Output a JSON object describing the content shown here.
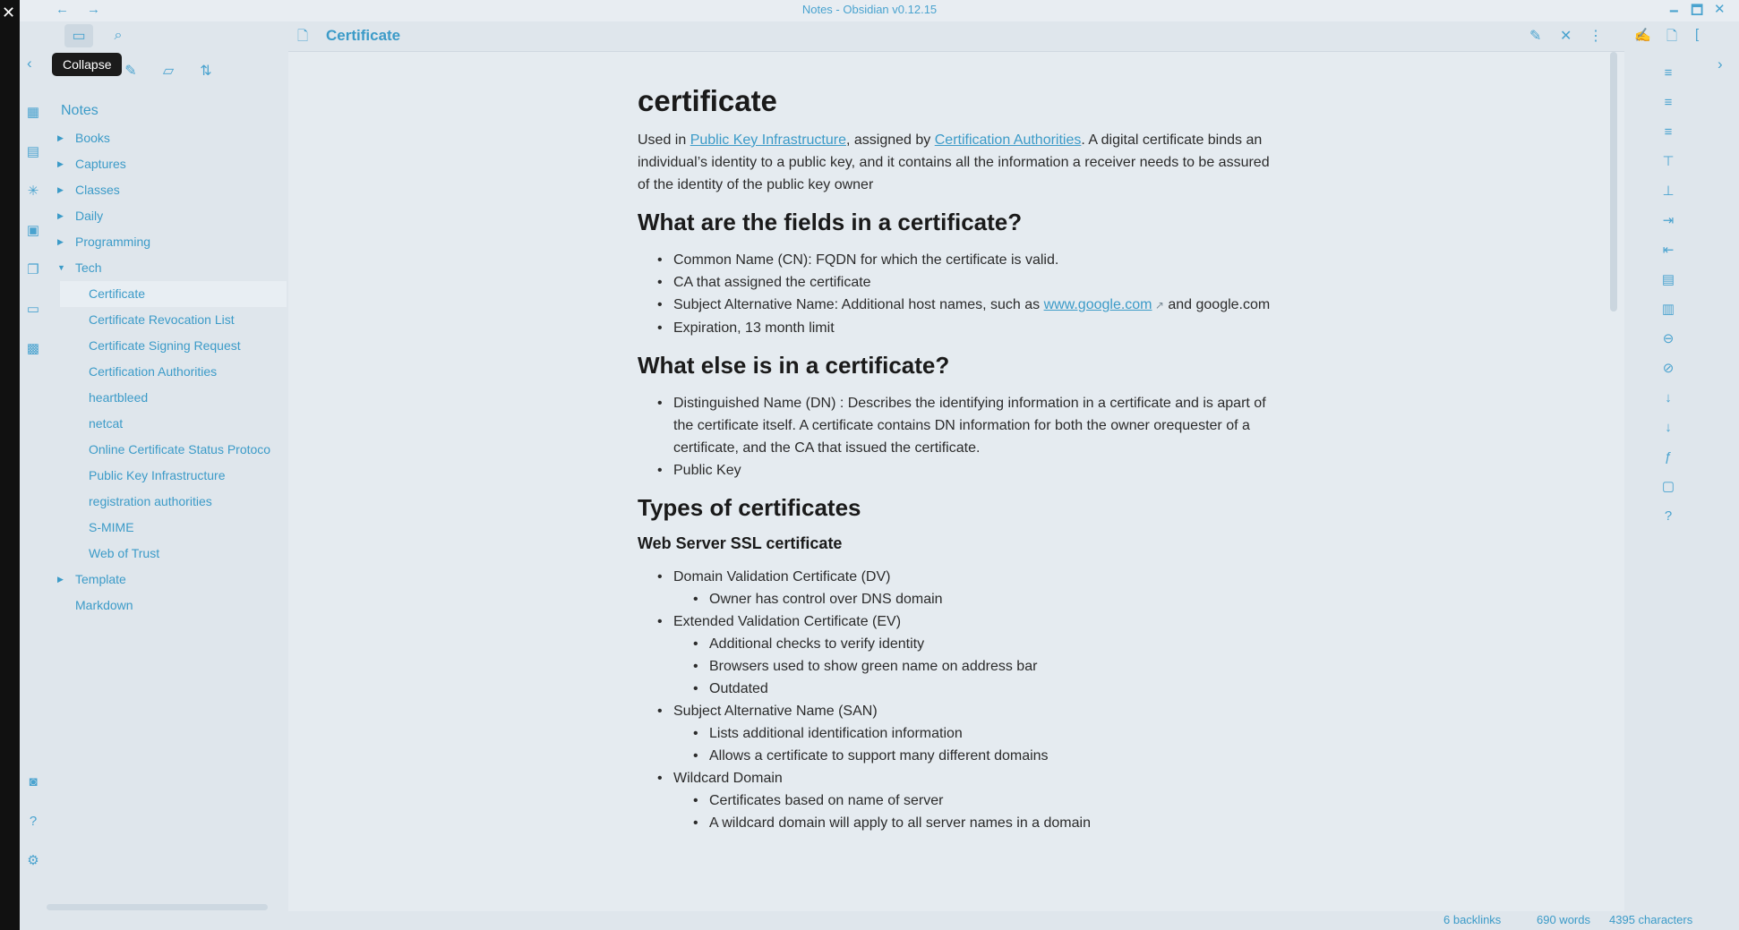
{
  "window": {
    "title": "Notes - Obsidian v0.12.15",
    "back": "←",
    "forward": "→",
    "minimize": "🗕",
    "maximize": "🗖",
    "close": "✕"
  },
  "ribbon": {
    "icons": [
      "table-icon",
      "note-icon",
      "graph-icon",
      "calendar-icon",
      "copy-icon",
      "slides-icon",
      "grid-icon",
      "publish-icon",
      "help-icon",
      "settings-icon"
    ]
  },
  "sidebar": {
    "tooltip": "Collapse",
    "vault_name": "Notes",
    "tree": [
      {
        "label": "Books",
        "type": "folder"
      },
      {
        "label": "Captures",
        "type": "folder"
      },
      {
        "label": "Classes",
        "type": "folder"
      },
      {
        "label": "Daily",
        "type": "folder"
      },
      {
        "label": "Programming",
        "type": "folder"
      },
      {
        "label": "Tech",
        "type": "folder-open"
      },
      {
        "label": "Certificate",
        "type": "file",
        "selected": true
      },
      {
        "label": "Certificate Revocation List",
        "type": "file"
      },
      {
        "label": "Certificate Signing Request",
        "type": "file"
      },
      {
        "label": "Certification Authorities",
        "type": "file"
      },
      {
        "label": "heartbleed",
        "type": "file"
      },
      {
        "label": "netcat",
        "type": "file"
      },
      {
        "label": "Online Certificate Status Protoco",
        "type": "file"
      },
      {
        "label": "Public Key Infrastructure",
        "type": "file"
      },
      {
        "label": "registration authorities",
        "type": "file"
      },
      {
        "label": "S-MIME",
        "type": "file"
      },
      {
        "label": "Web of Trust",
        "type": "file"
      },
      {
        "label": "Template",
        "type": "folder"
      },
      {
        "label": "Markdown",
        "type": "root-file"
      }
    ]
  },
  "pane": {
    "title": "Certificate"
  },
  "doc": {
    "h1": "certificate",
    "intro": {
      "t1": "Used in ",
      "l1": "Public Key Infrastructure",
      "t2": ", assigned by ",
      "l2": "Certification Authorities",
      "t3": ". A digital certificate binds an individual’s identity to a public key, and it contains all the information a receiver needs to be assured of the identity of the public key owner"
    },
    "h2_fields": "What are the fields in a certificate?",
    "fields": {
      "f1": "Common Name (CN): FQDN for which the certificate is valid.",
      "f2": "CA that assigned the certificate",
      "f3a": "Subject Alternative Name: Additional host names, such as ",
      "f3link": "www.google.com",
      "f3b": " and google.com",
      "f4": "Expiration, 13 month limit"
    },
    "h2_else": "What else is in a certificate?",
    "else_items": [
      "Distinguished Name (DN) : Describes the identifying information in a certificate and is apart of the certificate itself. A certificate contains DN information for both the owner orequester of a certificate, and the CA that issued the certificate.",
      "Public Key"
    ],
    "h2_types": "Types of certificates",
    "h3_web": "Web Server SSL certificate",
    "types": [
      {
        "text": "Domain Validation Certificate (DV)",
        "level": 1
      },
      {
        "text": "Owner has control over DNS domain",
        "level": 2
      },
      {
        "text": "Extended Validation Certificate (EV)",
        "level": 1
      },
      {
        "text": "Additional checks to verify identity",
        "level": 2
      },
      {
        "text": "Browsers used to show green name on address bar",
        "level": 2
      },
      {
        "text": "Outdated",
        "level": 2
      },
      {
        "text": "Subject Alternative Name (SAN)",
        "level": 1
      },
      {
        "text": "Lists additional identification information",
        "level": 2
      },
      {
        "text": "Allows a certificate to support many different domains",
        "level": 2
      },
      {
        "text": "Wildcard Domain",
        "level": 1
      },
      {
        "text": "Certificates based on name of server",
        "level": 2
      },
      {
        "text": "A wildcard domain will apply to all server names in a domain",
        "level": 2
      }
    ]
  },
  "status": {
    "backlinks": "6 backlinks",
    "words": "690 words",
    "chars": "4395 characters"
  },
  "colors": {
    "accent": "#3c9bc8",
    "background": "#e5ebf0"
  }
}
